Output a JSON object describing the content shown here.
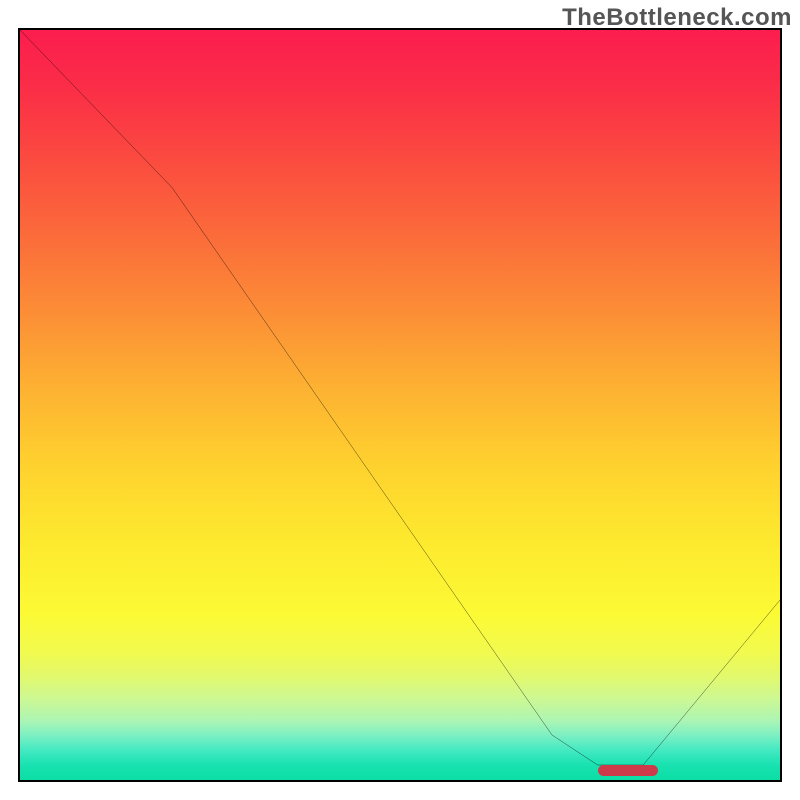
{
  "watermark": "TheBottleneck.com",
  "chart_data": {
    "type": "line",
    "title": "",
    "xlabel": "",
    "ylabel": "",
    "xlim": [
      0,
      100
    ],
    "ylim": [
      0,
      100
    ],
    "grid": false,
    "legend": false,
    "series": [
      {
        "name": "curve",
        "x": [
          0,
          20,
          70,
          76,
          82,
          100
        ],
        "y": [
          100,
          79,
          6,
          2,
          2,
          24
        ]
      }
    ],
    "marker": {
      "x_start": 76,
      "x_end": 84,
      "y": 1.3,
      "color": "#cf3a4b"
    },
    "background_gradient": {
      "top": "#fb1d4e",
      "mid": "#fde92e",
      "bottom": "#0cdea5"
    }
  }
}
